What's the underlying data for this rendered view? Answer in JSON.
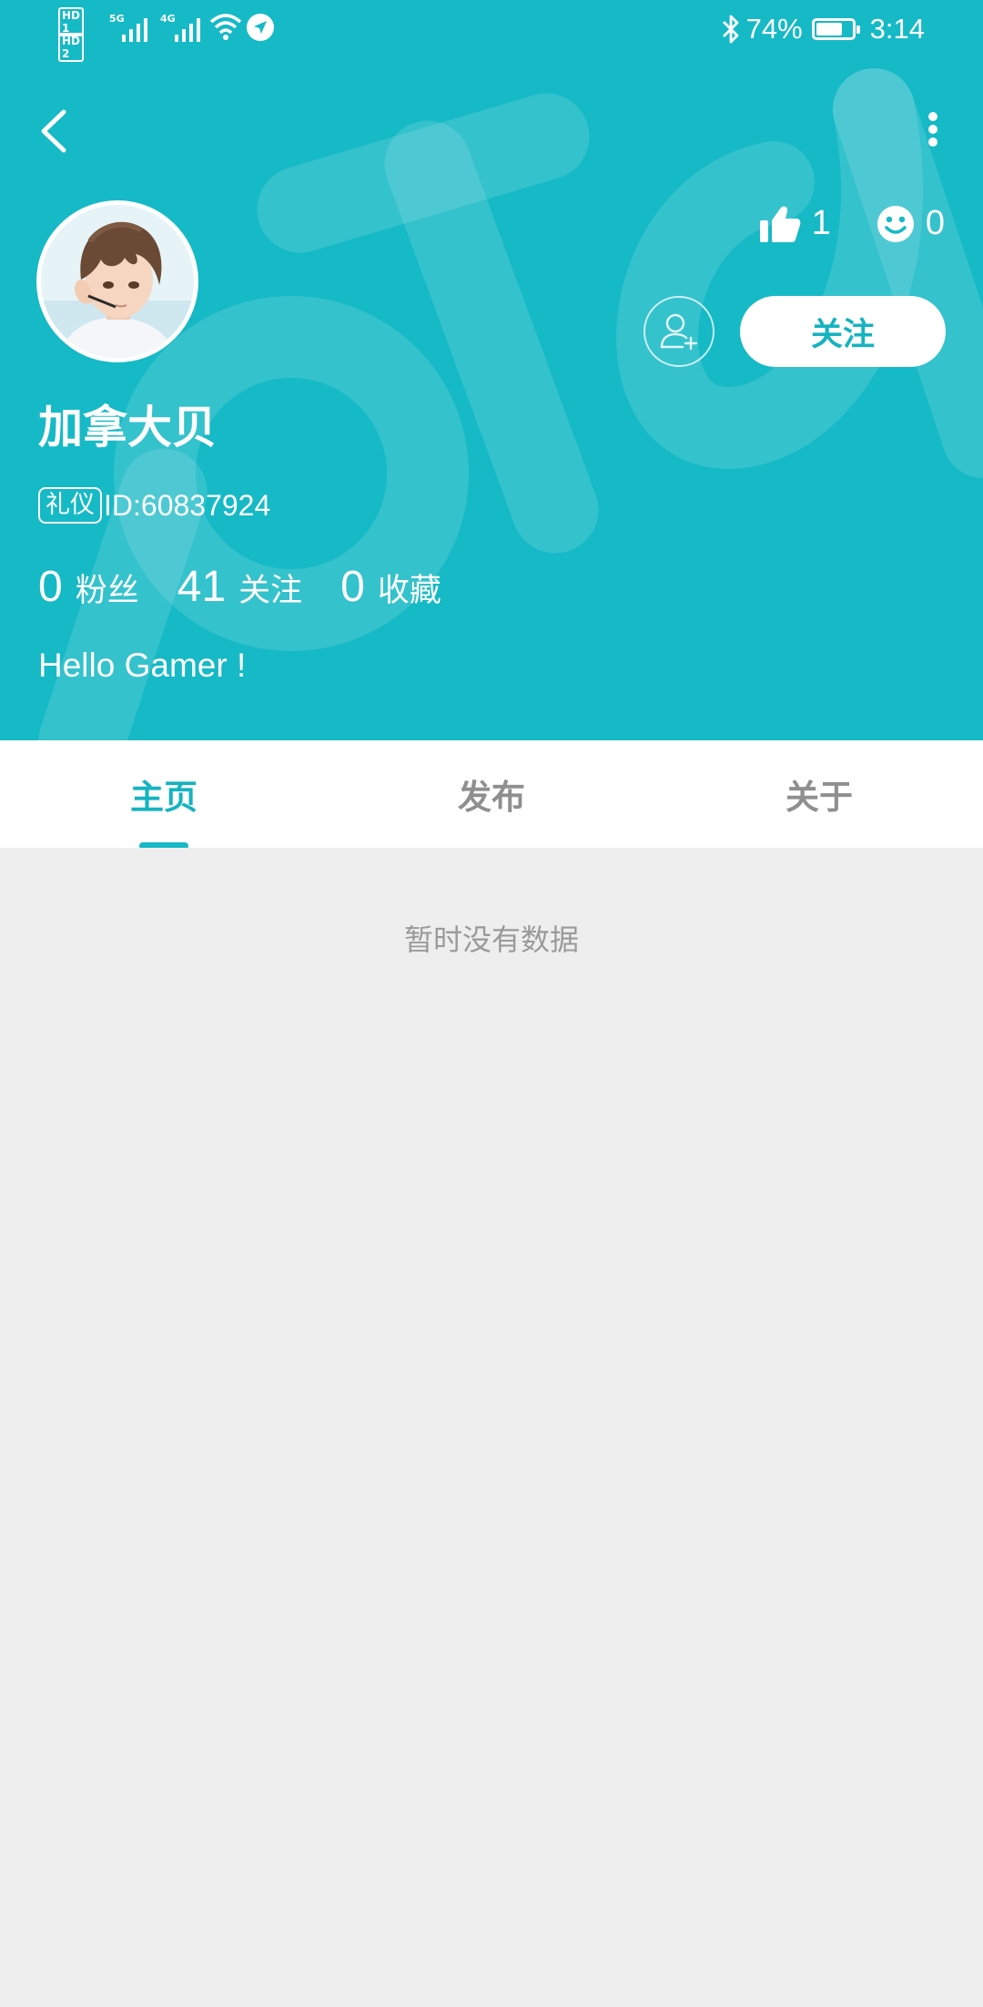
{
  "status_bar": {
    "sim1": "HD 1",
    "sim2": "HD 2",
    "net1": "5G",
    "net2": "4G",
    "battery_percent": "74%",
    "battery_level": 0.74,
    "time": "3:14"
  },
  "profile": {
    "name": "加拿大贝",
    "badge": "礼仪",
    "id_text": "ID:60837924",
    "likes": "1",
    "emoji_count": "0",
    "follow_label": "关注",
    "counts": [
      {
        "num": "0",
        "label": "粉丝"
      },
      {
        "num": "41",
        "label": "关注"
      },
      {
        "num": "0",
        "label": "收藏"
      }
    ],
    "bio": "Hello Gamer !"
  },
  "tabs": [
    {
      "label": "主页",
      "active": true
    },
    {
      "label": "发布",
      "active": false
    },
    {
      "label": "关于",
      "active": false
    }
  ],
  "content": {
    "empty_text": "暂时没有数据"
  },
  "colors": {
    "primary": "#16b9c6",
    "tab_active": "#16b3c0",
    "tab_inactive": "#8f8f8f",
    "background": "#eeeeee"
  },
  "icons": {
    "back": "chevron-left-icon",
    "more": "more-vertical-icon",
    "like": "thumbs-up-icon",
    "emoji": "smiley-icon",
    "add_friend": "add-user-icon"
  }
}
